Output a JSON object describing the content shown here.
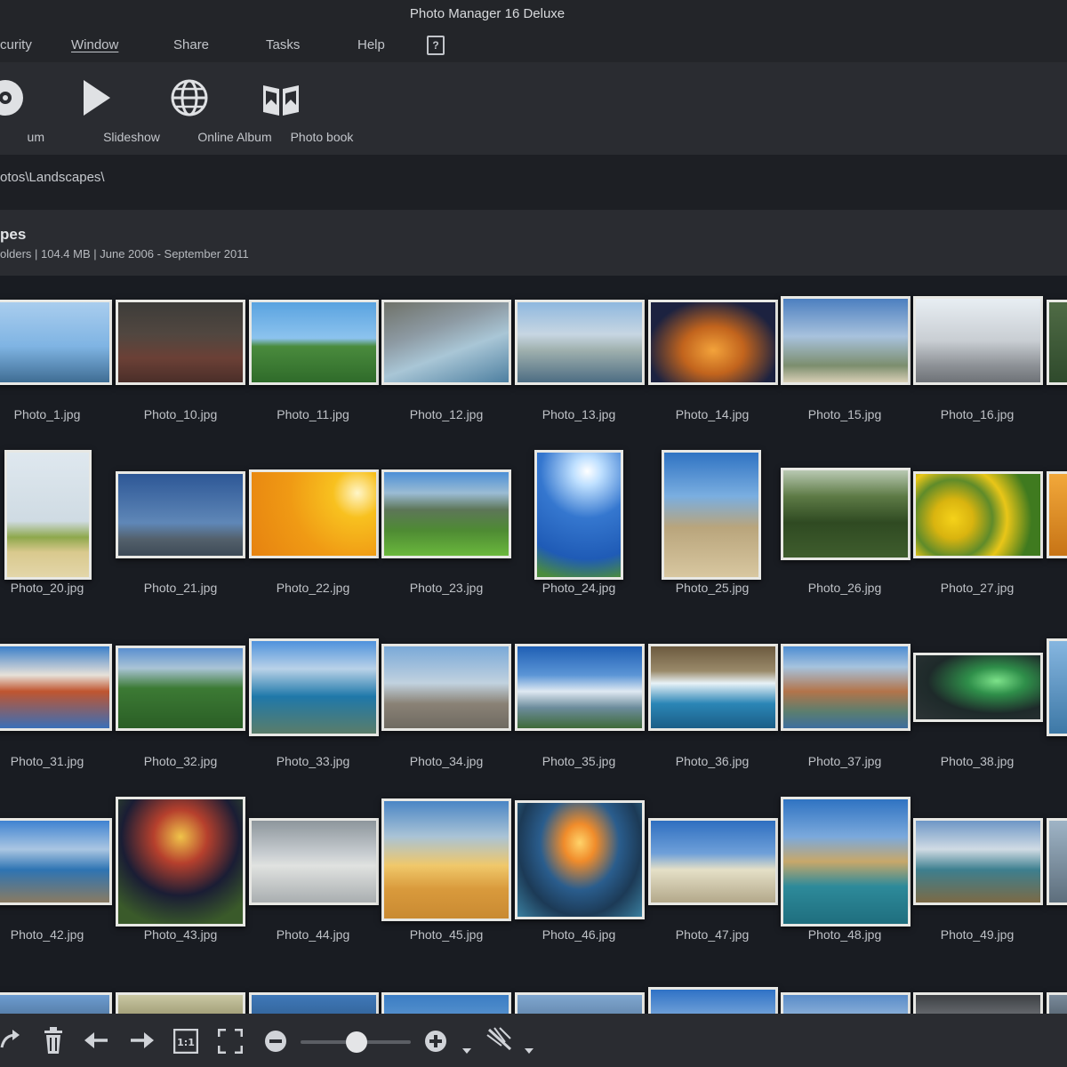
{
  "window": {
    "title": "Photo Manager 16 Deluxe"
  },
  "menu": {
    "items": [
      {
        "label": "curity"
      },
      {
        "label": "Window"
      },
      {
        "label": "Share"
      },
      {
        "label": "Tasks"
      },
      {
        "label": "Help"
      }
    ]
  },
  "toolbar": {
    "tools": [
      {
        "label": "um",
        "icon": "disc-icon"
      },
      {
        "label": "Slideshow",
        "icon": "play-icon"
      },
      {
        "label": "Online Album",
        "icon": "globe-icon"
      },
      {
        "label": "Photo book",
        "icon": "book-icon"
      }
    ]
  },
  "path": {
    "text": "otos\\Landscapes\\"
  },
  "album": {
    "name": "pes",
    "info": "olders | 104.4 MB | June 2006 - September 2011"
  },
  "photos": [
    {
      "name": "Photo_1.jpg"
    },
    {
      "name": "Photo_10.jpg"
    },
    {
      "name": "Photo_11.jpg"
    },
    {
      "name": "Photo_12.jpg"
    },
    {
      "name": "Photo_13.jpg"
    },
    {
      "name": "Photo_14.jpg"
    },
    {
      "name": "Photo_15.jpg"
    },
    {
      "name": "Photo_16.jpg"
    },
    {
      "name": "Photo_20.jpg"
    },
    {
      "name": "Photo_21.jpg"
    },
    {
      "name": "Photo_22.jpg"
    },
    {
      "name": "Photo_23.jpg"
    },
    {
      "name": "Photo_24.jpg"
    },
    {
      "name": "Photo_25.jpg"
    },
    {
      "name": "Photo_26.jpg"
    },
    {
      "name": "Photo_27.jpg"
    },
    {
      "name": "Photo_31.jpg"
    },
    {
      "name": "Photo_32.jpg"
    },
    {
      "name": "Photo_33.jpg"
    },
    {
      "name": "Photo_34.jpg"
    },
    {
      "name": "Photo_35.jpg"
    },
    {
      "name": "Photo_36.jpg"
    },
    {
      "name": "Photo_37.jpg"
    },
    {
      "name": "Photo_38.jpg"
    },
    {
      "name": "Photo_42.jpg"
    },
    {
      "name": "Photo_43.jpg"
    },
    {
      "name": "Photo_44.jpg"
    },
    {
      "name": "Photo_45.jpg"
    },
    {
      "name": "Photo_46.jpg"
    },
    {
      "name": "Photo_47.jpg"
    },
    {
      "name": "Photo_48.jpg"
    },
    {
      "name": "Photo_49.jpg"
    }
  ],
  "bottombar": {
    "zoom_level": 0.48,
    "icons": [
      "redo-icon",
      "trash-icon",
      "arrow-left-icon",
      "arrow-right-icon",
      "actual-size-icon",
      "fullscreen-icon",
      "zoom-out-icon",
      "zoom-in-icon",
      "chevron-down-icon",
      "magic-wand-icon",
      "chevron-down-icon"
    ]
  }
}
